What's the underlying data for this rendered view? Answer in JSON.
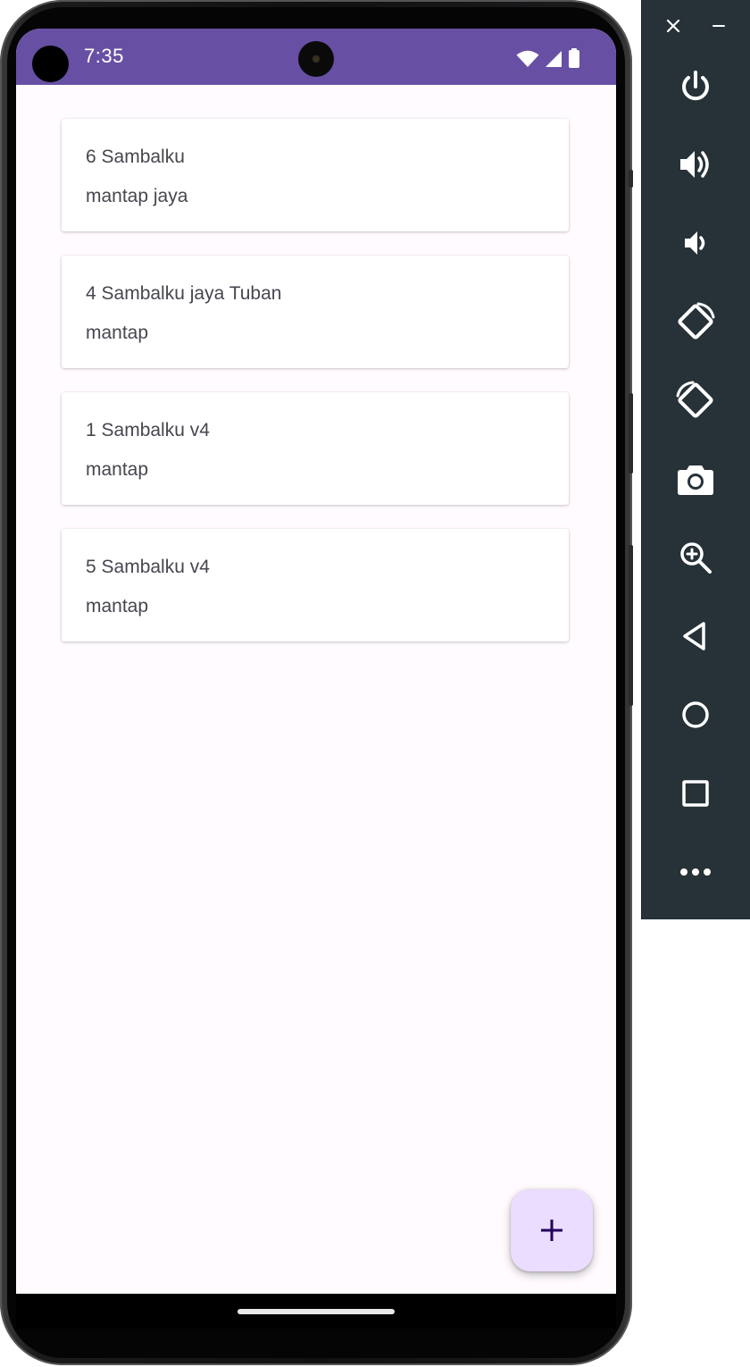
{
  "status_bar": {
    "time": "7:35",
    "background_color": "#6750a4",
    "icons": [
      "wifi-icon",
      "cell-signal-icon",
      "battery-icon"
    ]
  },
  "screen": {
    "background_color": "#fffbfe"
  },
  "notes": [
    {
      "title": "6 Sambalku",
      "body": "mantap jaya"
    },
    {
      "title": "4 Sambalku jaya Tuban",
      "body": "mantap"
    },
    {
      "title": "1 Sambalku v4",
      "body": "mantap"
    },
    {
      "title": "5 Sambalku v4",
      "body": "mantap"
    }
  ],
  "fab": {
    "icon": "plus-icon",
    "color": "#eaddff"
  },
  "emulator_toolbar": {
    "window_controls": [
      "close-icon",
      "minimize-icon"
    ],
    "buttons": [
      "power-icon",
      "volume-up-icon",
      "volume-down-icon",
      "rotate-left-icon",
      "rotate-right-icon",
      "camera-icon",
      "zoom-icon",
      "back-icon",
      "home-icon",
      "overview-icon",
      "more-icon"
    ],
    "background_color": "#263238"
  }
}
